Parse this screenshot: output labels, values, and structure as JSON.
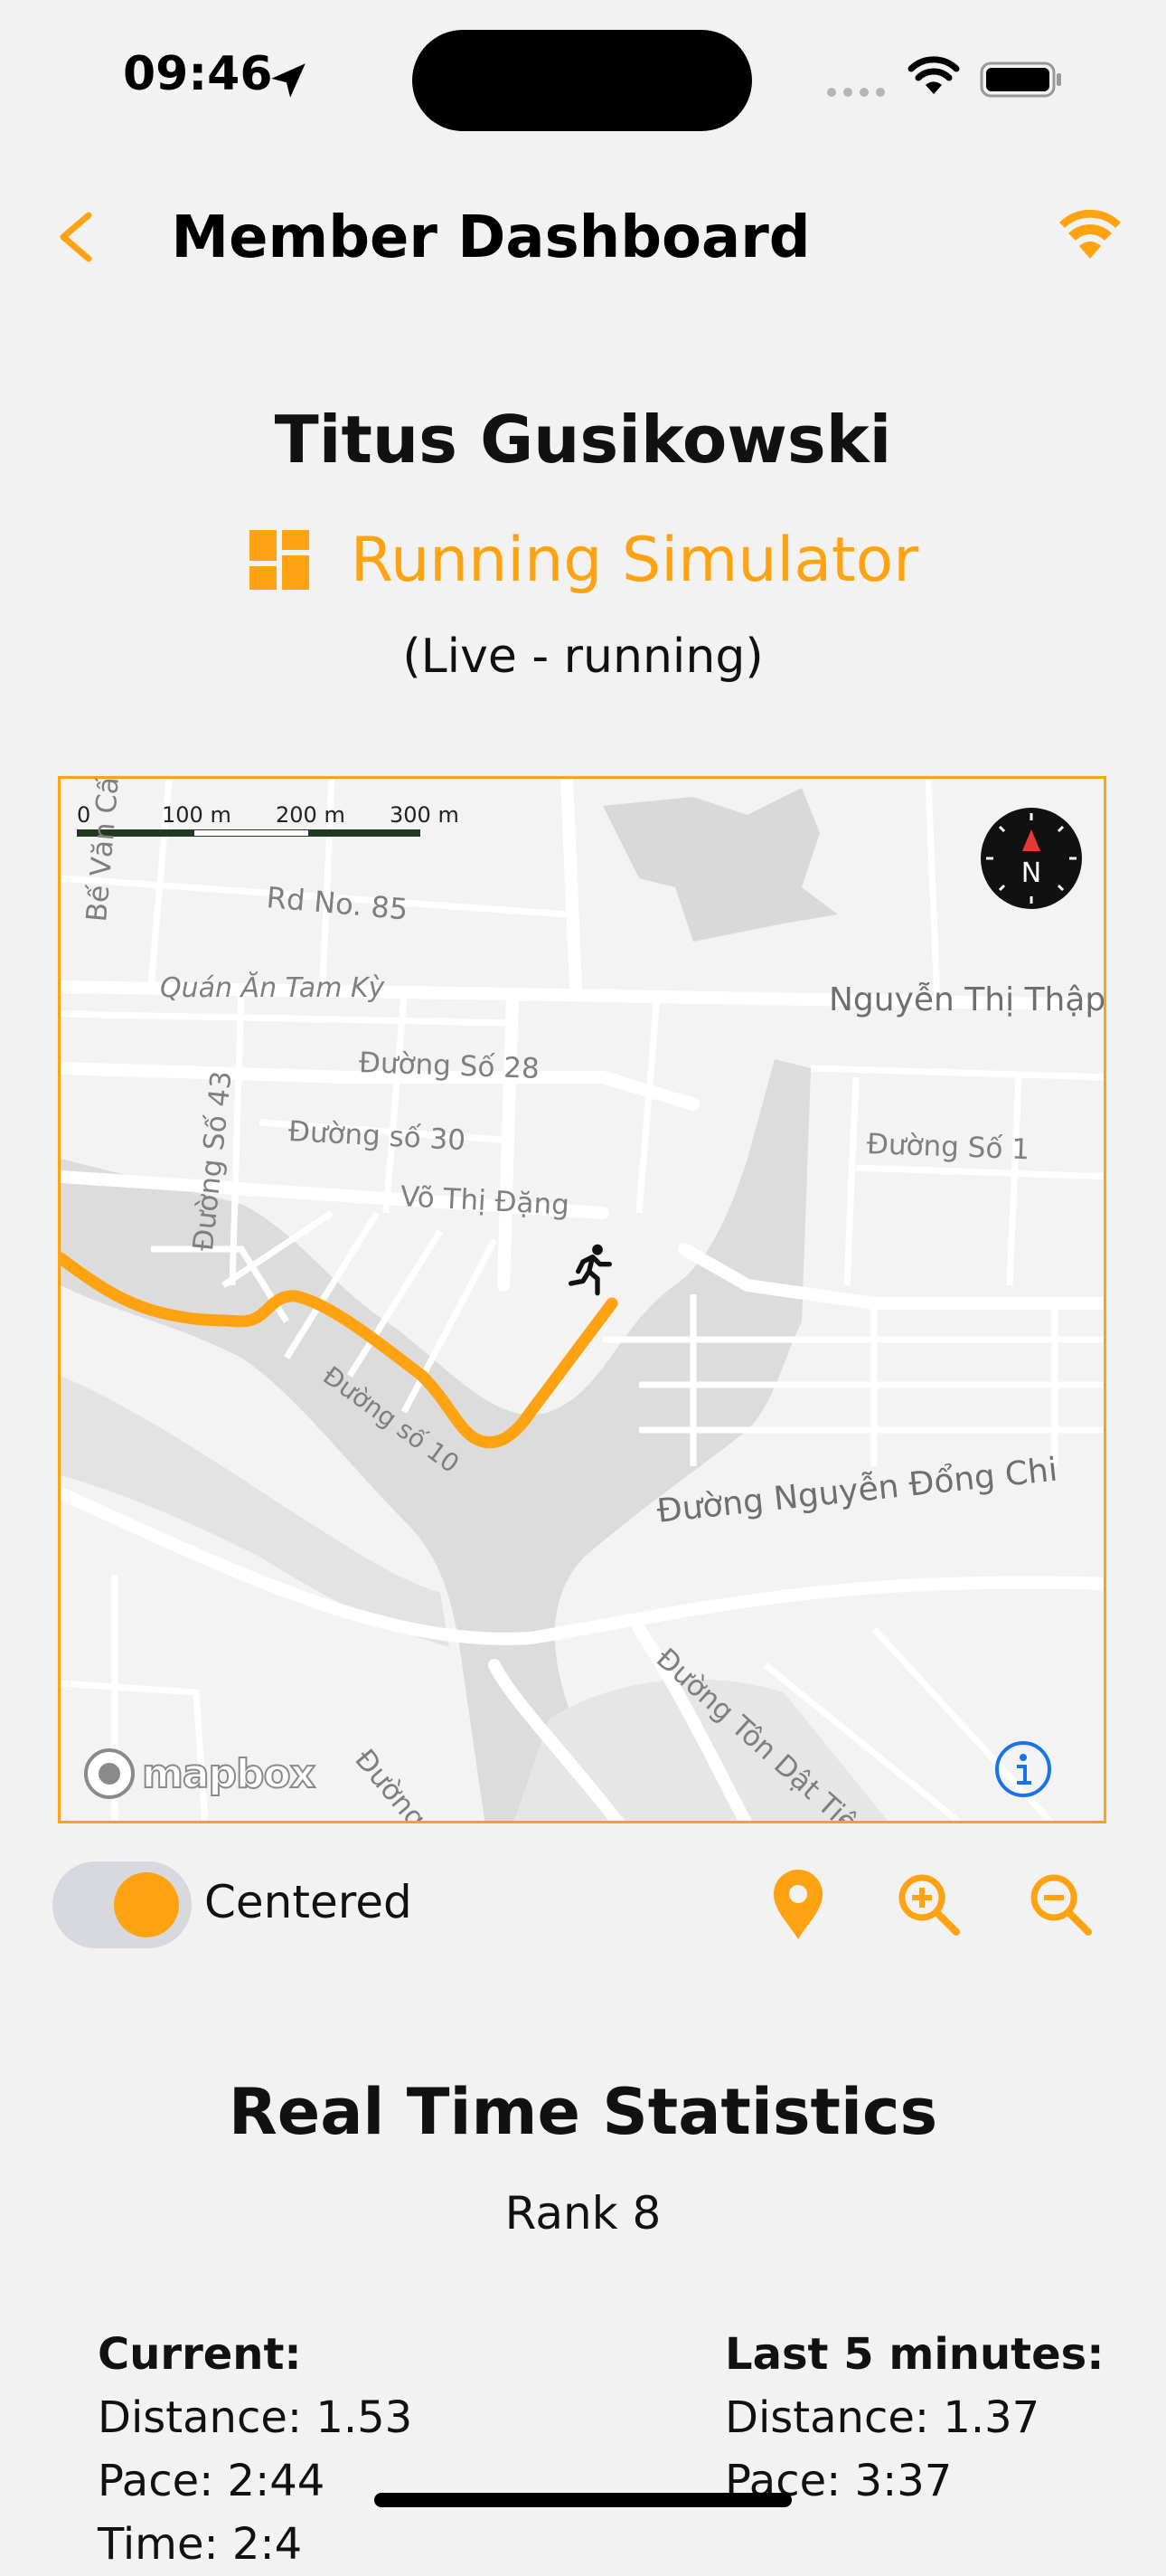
{
  "status_bar": {
    "time": "09:46"
  },
  "nav": {
    "title": "Member Dashboard",
    "back_icon": "chevron-left-icon",
    "signal_icon": "broadcast-icon"
  },
  "colors": {
    "accent": "#ffa312",
    "route": "#ffa312",
    "info_blue": "#1a73e8"
  },
  "member": {
    "name": "Titus Gusikowski",
    "activity": "Running Simulator",
    "status": "(Live - running)"
  },
  "map": {
    "scale": {
      "labels": [
        "0",
        "100 m",
        "200 m",
        "300 m"
      ]
    },
    "street_labels": {
      "be_van_cam": "Bế Văn Cấm",
      "rd_85": "Rd No. 85",
      "quan_an": "Quán Ăn Tam Kỳ",
      "nguyen_thi_thap": "Nguyễn Thị Thập",
      "duong_so_28": "Đường Số 28",
      "duong_so_43": "Đường Số 43",
      "duong_so_30": "Đường số 30",
      "vo_thi_dang": "Võ Thị Đặng",
      "duong_so_1": "Đường Số 1",
      "duong_so_10": "Đường số 10",
      "nguyen_dong_chi": "Đường Nguyễn Đổng Chi",
      "ton_dat_tien": "Đường Tôn Dật Tiên",
      "duong_n": "Đường N"
    },
    "compass_letter": "N",
    "attribution": "mapbox"
  },
  "controls": {
    "toggle_label": "Centered",
    "toggle_on": true
  },
  "stats": {
    "title": "Real Time Statistics",
    "rank": "Rank 8",
    "current": {
      "heading": "Current:",
      "distance": "Distance: 1.53",
      "pace": "Pace: 2:44",
      "time": "Time: 2:4"
    },
    "last5": {
      "heading": "Last 5 minutes:",
      "distance": "Distance: 1.37",
      "pace": "Pace: 3:37"
    }
  }
}
